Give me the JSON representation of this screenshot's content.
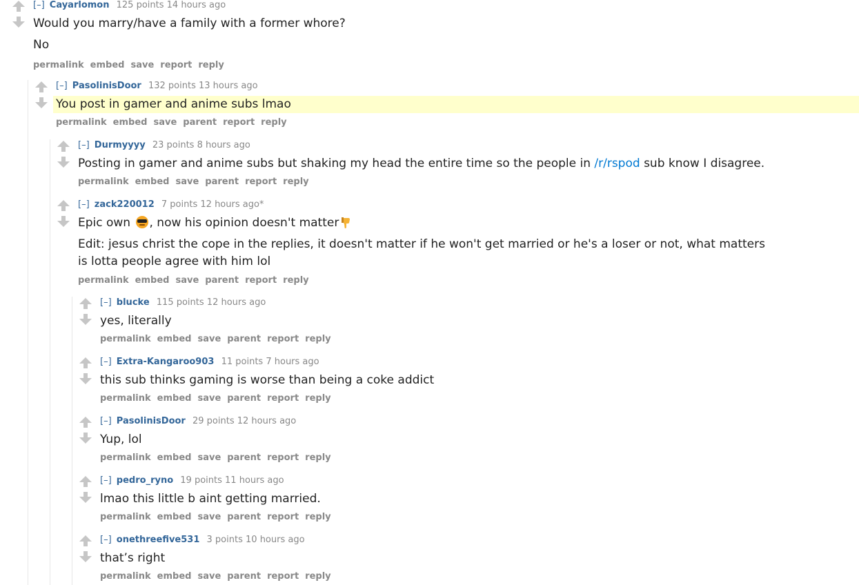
{
  "vote_arrow_color": "#c6c6c6",
  "comments": [
    {
      "author": "Cayarlomon",
      "expand": "[–]",
      "score": "125 points",
      "time": "14 hours ago",
      "paragraphs": [
        "Would you marry/have a family with a former whore?",
        "No"
      ],
      "buttons": [
        "permalink",
        "embed",
        "save",
        "report",
        "reply"
      ]
    },
    {
      "author": "PasolinisDoor",
      "expand": "[–]",
      "score": "132 points",
      "time": "13 hours ago",
      "paragraphs": [
        "You post in gamer and anime subs lmao"
      ],
      "buttons": [
        "permalink",
        "embed",
        "save",
        "parent",
        "report",
        "reply"
      ]
    },
    {
      "author": "Durmyyyy",
      "expand": "[–]",
      "score": "23 points",
      "time": "8 hours ago",
      "body_before_link": "Posting in gamer and anime subs but shaking my head the entire time so the people in ",
      "link_text": "/r/rspod",
      "body_after_link": " sub know I disagree.",
      "buttons": [
        "permalink",
        "embed",
        "save",
        "parent",
        "report",
        "reply"
      ]
    },
    {
      "author": "zack220012",
      "expand": "[–]",
      "score": "7 points",
      "time": "12 hours ago*",
      "line1_before": "Epic own ",
      "line1_after": ", now his opinion doesn't matter",
      "emoji1": "sunglasses-emoji",
      "emoji2": "thumbs-down-emoji",
      "edit_line1": "Edit: jesus christ the cope in the replies, it doesn't matter if he won't get married or he's a loser or not, what matters",
      "edit_line2": "is lotta people agree with him lol",
      "buttons": [
        "permalink",
        "embed",
        "save",
        "parent",
        "report",
        "reply"
      ]
    },
    {
      "author": "blucke",
      "expand": "[–]",
      "score": "115 points",
      "time": "12 hours ago",
      "paragraphs": [
        "yes, literally"
      ],
      "buttons": [
        "permalink",
        "embed",
        "save",
        "parent",
        "report",
        "reply"
      ]
    },
    {
      "author": "Extra-Kangaroo903",
      "expand": "[–]",
      "score": "11 points",
      "time": "7 hours ago",
      "paragraphs": [
        "this sub thinks gaming is worse than being a coke addict"
      ],
      "buttons": [
        "permalink",
        "embed",
        "save",
        "parent",
        "report",
        "reply"
      ]
    },
    {
      "author": "PasolinisDoor",
      "expand": "[–]",
      "score": "29 points",
      "time": "12 hours ago",
      "paragraphs": [
        "Yup, lol"
      ],
      "buttons": [
        "permalink",
        "embed",
        "save",
        "parent",
        "report",
        "reply"
      ]
    },
    {
      "author": "pedro_ryno",
      "expand": "[–]",
      "score": "19 points",
      "time": "11 hours ago",
      "paragraphs": [
        "lmao this little b aint getting married."
      ],
      "buttons": [
        "permalink",
        "embed",
        "save",
        "parent",
        "report",
        "reply"
      ]
    },
    {
      "author": "onethreefive531",
      "expand": "[–]",
      "score": "3 points",
      "time": "10 hours ago",
      "paragraphs": [
        "that’s right"
      ],
      "buttons": [
        "permalink",
        "embed",
        "save",
        "parent",
        "report",
        "reply"
      ]
    }
  ]
}
